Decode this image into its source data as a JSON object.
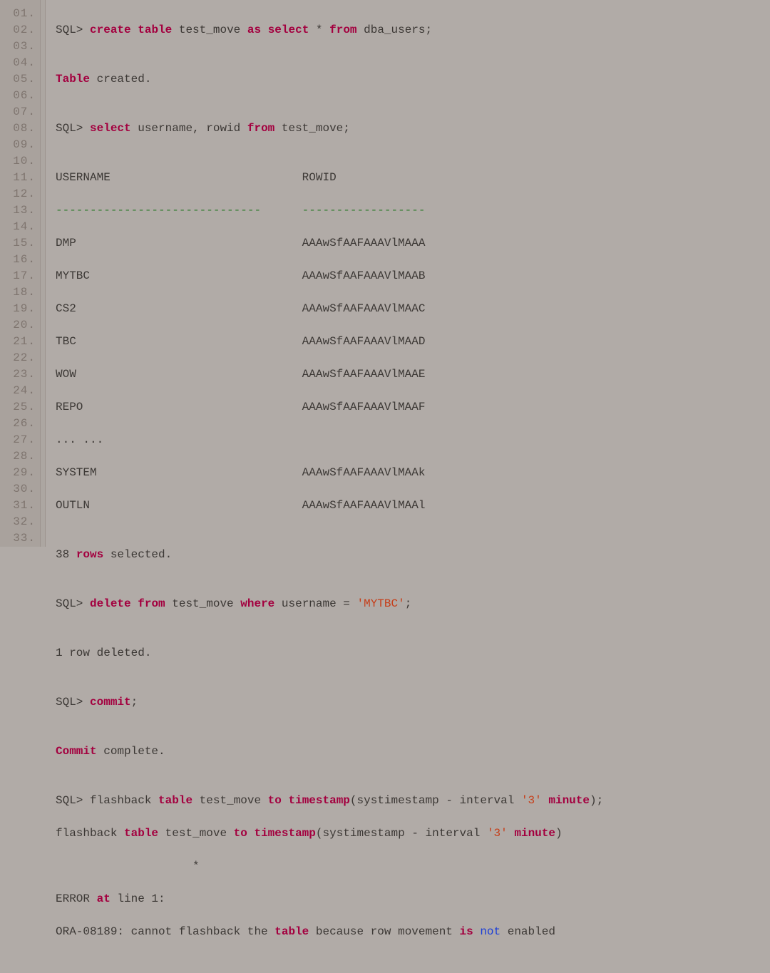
{
  "gutter": [
    "01.",
    "02.",
    "03.",
    "04.",
    "05.",
    "06.",
    "07.",
    "08.",
    "09.",
    "10.",
    "11.",
    "12.",
    "13.",
    "14.",
    "15.",
    "16.",
    "17.",
    "18.",
    "19.",
    "20.",
    "21.",
    "22.",
    "23.",
    "24.",
    "25.",
    "26.",
    "27.",
    "28.",
    "29.",
    "30.",
    "31.",
    "32.",
    "33."
  ],
  "l1": {
    "a": "SQL> ",
    "kw1": "create",
    "sp1": " ",
    "kw2": "table",
    "b": " test_move ",
    "kw3": "as",
    "sp2": " ",
    "kw4": "select",
    "c": " * ",
    "kw5": "from",
    "d": " dba_users;"
  },
  "l2": "",
  "l3": {
    "kw": "Table",
    "rest": " created."
  },
  "l4": "",
  "l5": {
    "a": "SQL> ",
    "kw1": "select",
    "b": " username, rowid ",
    "kw2": "from",
    "c": " test_move;"
  },
  "l6": "",
  "l7": "USERNAME                            ROWID",
  "l8": "------------------------------      ------------------",
  "l9": "DMP                                 AAAwSfAAFAAAVlMAAA",
  "l10": "MYTBC                               AAAwSfAAFAAAVlMAAB",
  "l11": "CS2                                 AAAwSfAAFAAAVlMAAC",
  "l12": "TBC                                 AAAwSfAAFAAAVlMAAD",
  "l13": "WOW                                 AAAwSfAAFAAAVlMAAE",
  "l14": "REPO                                AAAwSfAAFAAAVlMAAF",
  "l15": "... ...",
  "l16": "SYSTEM                              AAAwSfAAFAAAVlMAAk",
  "l17": "OUTLN                               AAAwSfAAFAAAVlMAAl",
  "l18": "",
  "l19": {
    "a": "38 ",
    "kw": "rows",
    "b": " selected."
  },
  "l20": "",
  "l21": {
    "a": "SQL> ",
    "kw1": "delete",
    "sp1": " ",
    "kw2": "from",
    "b": " test_move ",
    "kw3": "where",
    "c": " username = ",
    "str": "'MYTBC'",
    "d": ";"
  },
  "l22": "",
  "l23": "1 row deleted.",
  "l24": "",
  "l25": {
    "a": "SQL> ",
    "kw": "commit",
    "b": ";"
  },
  "l26": "",
  "l27": {
    "kw": "Commit",
    "rest": " complete."
  },
  "l28": "",
  "l29": {
    "a": "SQL> flashback ",
    "kw1": "table",
    "b": " test_move ",
    "kw2": "to",
    "sp1": " ",
    "kw3": "timestamp",
    "c": "(systimestamp - interval ",
    "str": "'3'",
    "sp2": " ",
    "kw4": "minute",
    "d": ");"
  },
  "l30": {
    "a": "flashback ",
    "kw1": "table",
    "b": " test_move ",
    "kw2": "to",
    "sp1": " ",
    "kw3": "timestamp",
    "c": "(systimestamp - interval ",
    "str": "'3'",
    "sp2": " ",
    "kw4": "minute",
    "d": ")"
  },
  "l31": "                    *",
  "l32": {
    "a": "ERROR ",
    "kw": "at",
    "b": " line 1:"
  },
  "l33": {
    "a": "ORA-08189: cannot flashback the ",
    "kw1": "table",
    "b": " because row movement ",
    "kw2": "is",
    "sp": " ",
    "blue": "not",
    "c": " enabled"
  }
}
